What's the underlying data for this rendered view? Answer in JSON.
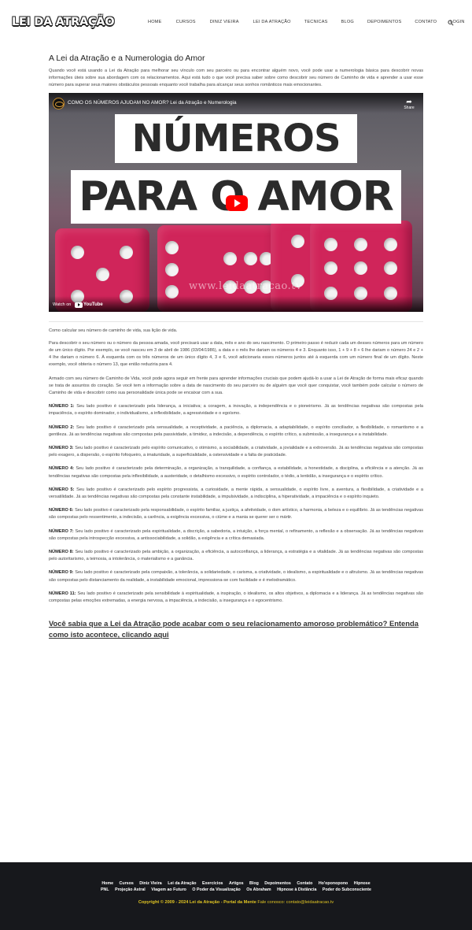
{
  "header": {
    "logo_text": "LEI DA ATRAÇÃO",
    "nav": [
      "Home",
      "CURSOS",
      "DINIZ VIEIRA",
      "LEI DA ATRAÇÃO",
      "TECNICAS",
      "BLOG",
      "DEPOIMENTOS",
      "CONTATO",
      "LOGIN"
    ],
    "search_icon": "search-icon"
  },
  "main": {
    "title": "A Lei da Atração e a Numerologia do Amor",
    "intro": "Quando você está usando a Lei da Atração para melhorar seu vínculo com seu parceiro ou para encontrar alguém novo, você pode usar a numerologia básica para descobrir novas informações úteis sobre sua abordagem com os relacionamentos. Aqui está tudo o que você precisa saber sobre como descobrir seu número de Caminho de vida e aprender a usar esse número para superar seus maiores obstáculos pessoais enquanto você trabalha para alcançar seus sonhos românticos mais emocionantes.",
    "video": {
      "title": "COMO OS NÚMEROS AJUDAM NO AMOR? Lei da Atração e Numerologia",
      "share_label": "Share",
      "thumb_line1": "NÚMEROS",
      "thumb_line2": "PARA O AMOR",
      "watermark": "www.leidaatracao.tv",
      "watch_on": "Watch on",
      "youtube": "YouTube"
    },
    "how_to": "Como calcular seu número de caminho de vida, sua lição de vida.",
    "calc": "Para descobrir o seu número ou o número da pessoa amada, você precisará usar a data, mês e ano do seu nascimento. O primeiro passo é reduzir cada um desses números para um número de um único dígito. Por exemplo, se você nasceu em 3 de abril de 1986 (03/04/1986), a data e o mês lhe dariam os números 4 e 3. Enquanto isso, 1 + 9 + 8 + 6 lhe dariam o número 24 e 2 + 4 lhe dariam o número 6. À esquerda com os três números de um único dígito 4, 3 e 6, você adicionaria esses números juntos até à esquerda com um número final de um dígito. Neste exemplo, você obteria o número 13, que então reduziria para 4.",
    "armed": "Armado com seu número de Caminho de Vida, você pode agora seguir em frente para aprender informações cruciais que podem ajudá-lo a usar a Lei de Atração de forma mais eficaz quando se trata de assuntos do coração. Se você tem a informação sobre a data de nascimento do seu parceiro ou de alguém que você quer conquistar, você também pode calcular o número de Caminho de vida e descobrir como sua personalidade única pode se encaixar com a sua.",
    "numbers": [
      {
        "label": "NÚMERO 1:",
        "text": "Seu lado positivo é caracterizado pela liderança, a iniciativa; a coragem, a inovação, a independência e o pioneirismo. Já as tendências negativas são compostas pela impaciência, o espírito dominador, o individualismo, a inflexibilidade, a agressividade e o egoísmo."
      },
      {
        "label": "NÚMERO 2:",
        "text": "Seu lado positivo é caracterizado pela sensualidade, a receptividade, a paciência, a diplomacia, a adaptabilidade, o espírito conciliador, a flexibilidade, o romantismo e a gentileza. Já as tendências negativas são compostas pela passividade, a timidez, a indecisão, a dependência, o espírito crítico, a submissão, a insegurança e a instabilidade."
      },
      {
        "label": "NÚMERO 3:",
        "text": "Seu lado positivo é caracterizado pelo espírito comunicativo, o otimismo, a sociabilidade, a criatividade, a jovialidade e a extroversão. Já as tendências negativas são compostas pelo exagero, a dispersão, o espírito fofoqueiro, a imaturidade, a superficialidade, a ostensividade e a falta de praticidade."
      },
      {
        "label": "NÚMERO 4:",
        "text": "Seu lado positivo é caracterizado pela determinação, a organização, a tranquilidade, a confiança, a estabilidade, a honestidade, a disciplina, a eficiência e a atenção. Já as tendências negativas são compostas pela inflexibilidade, a austeridade, o detalhismo excessivo, o espírito controlador, o tédio, a lentidão, a insegurança e o espírito crítico."
      },
      {
        "label": "NÚMERO 5:",
        "text": "Seu lado positivo é caracterizado pelo espírito progressista, a curiosidade, a mente rápida, a sensualidade, o espírito livre, a aventura, a flexibilidade, a criatividade e a versatilidade. Já as tendências negativas são compostas pela constante instabilidade, a impulsividade, a indisciplina, a hiperatividade, a impaciência e o espírito inquieto."
      },
      {
        "label": "NÚMERO 6:",
        "text": "Seu lado positivo é caracterizado pela responsabilidade, o espírito familiar, a justiça, a afetividade, o dom artístico, a harmonia, a beleza e o equilíbrio. Já as tendências negativas são compostas pelo ressentimento, a indecisão, a carência, a exigência excessiva, o ciúme e a mania se querer ser o mártir."
      },
      {
        "label": "NÚMERO 7:",
        "text": "Seu lado positivo é caracterizado pela espiritualidade, a discrição, a sabedoria, a intuição, a força mental, o refinamento, a reflexão e a observação. Já as tendências negativas são compostas pela introspecção excessiva, a antissociabilidade, a solidão, a exigência e a crítica demasiada."
      },
      {
        "label": "NÚMERO 8:",
        "text": "Seu lado positivo é caracterizado pela ambição, a organização, a eficiência, a autoconfiança, a liderança, a estratégia e a vitalidade. Já as tendências negativas são compostas pelo autoritarismo, a teimosia, a intolerância, o materialismo e a ganância."
      },
      {
        "label": "NÚMERO 9:",
        "text": "Seu lado positivo é caracterizado pela compaixão, a tolerância, a solidariedade, o carisma, a criatividade, o idealismo, a espiritualidade e o altruísmo. Já as tendências negativas são compostas pelo distanciamento da realidade, a instabilidade emocional, impressiona-se com facilidade e é melodramático."
      },
      {
        "label": "NÚMERO 11:",
        "text": "Seu lado positivo é caracterizado pela sensibilidade à espiritualidade, a inspiração, o idealismo, os altos objetivos, a diplomacia e a liderança. Já as tendências negativas são compostas pelas emoções extremadas, a energia nervosa, a impaciência, a indecisão, a insegurança e o egocentrismo."
      }
    ],
    "cta": "Você sabia que a Lei da Atração pode acabar com o seu relacionamento amoroso problemático? Entenda como isto acontece, clicando aqui"
  },
  "footer": {
    "links_row1": [
      "Home",
      "Cursos",
      "Diniz Vieira",
      "Lei da Atração",
      "Exercícios",
      "Artigos",
      "Blog",
      "Depoimentos",
      "Contato",
      "Ho'oponopono",
      "Hipnose"
    ],
    "links_row2": [
      "PNL",
      "Projeção Astral",
      "Viagem ao Futuro",
      "O Poder da Visualização",
      "Os Abraham",
      "Hipnose à Distância",
      "Poder do Subconsciente"
    ],
    "copyright": "Copyright © 2009 - 2024 Lei da Atração - Portal da Mente",
    "contact": "Fale conosco: contato@leidaatracao.tv"
  }
}
